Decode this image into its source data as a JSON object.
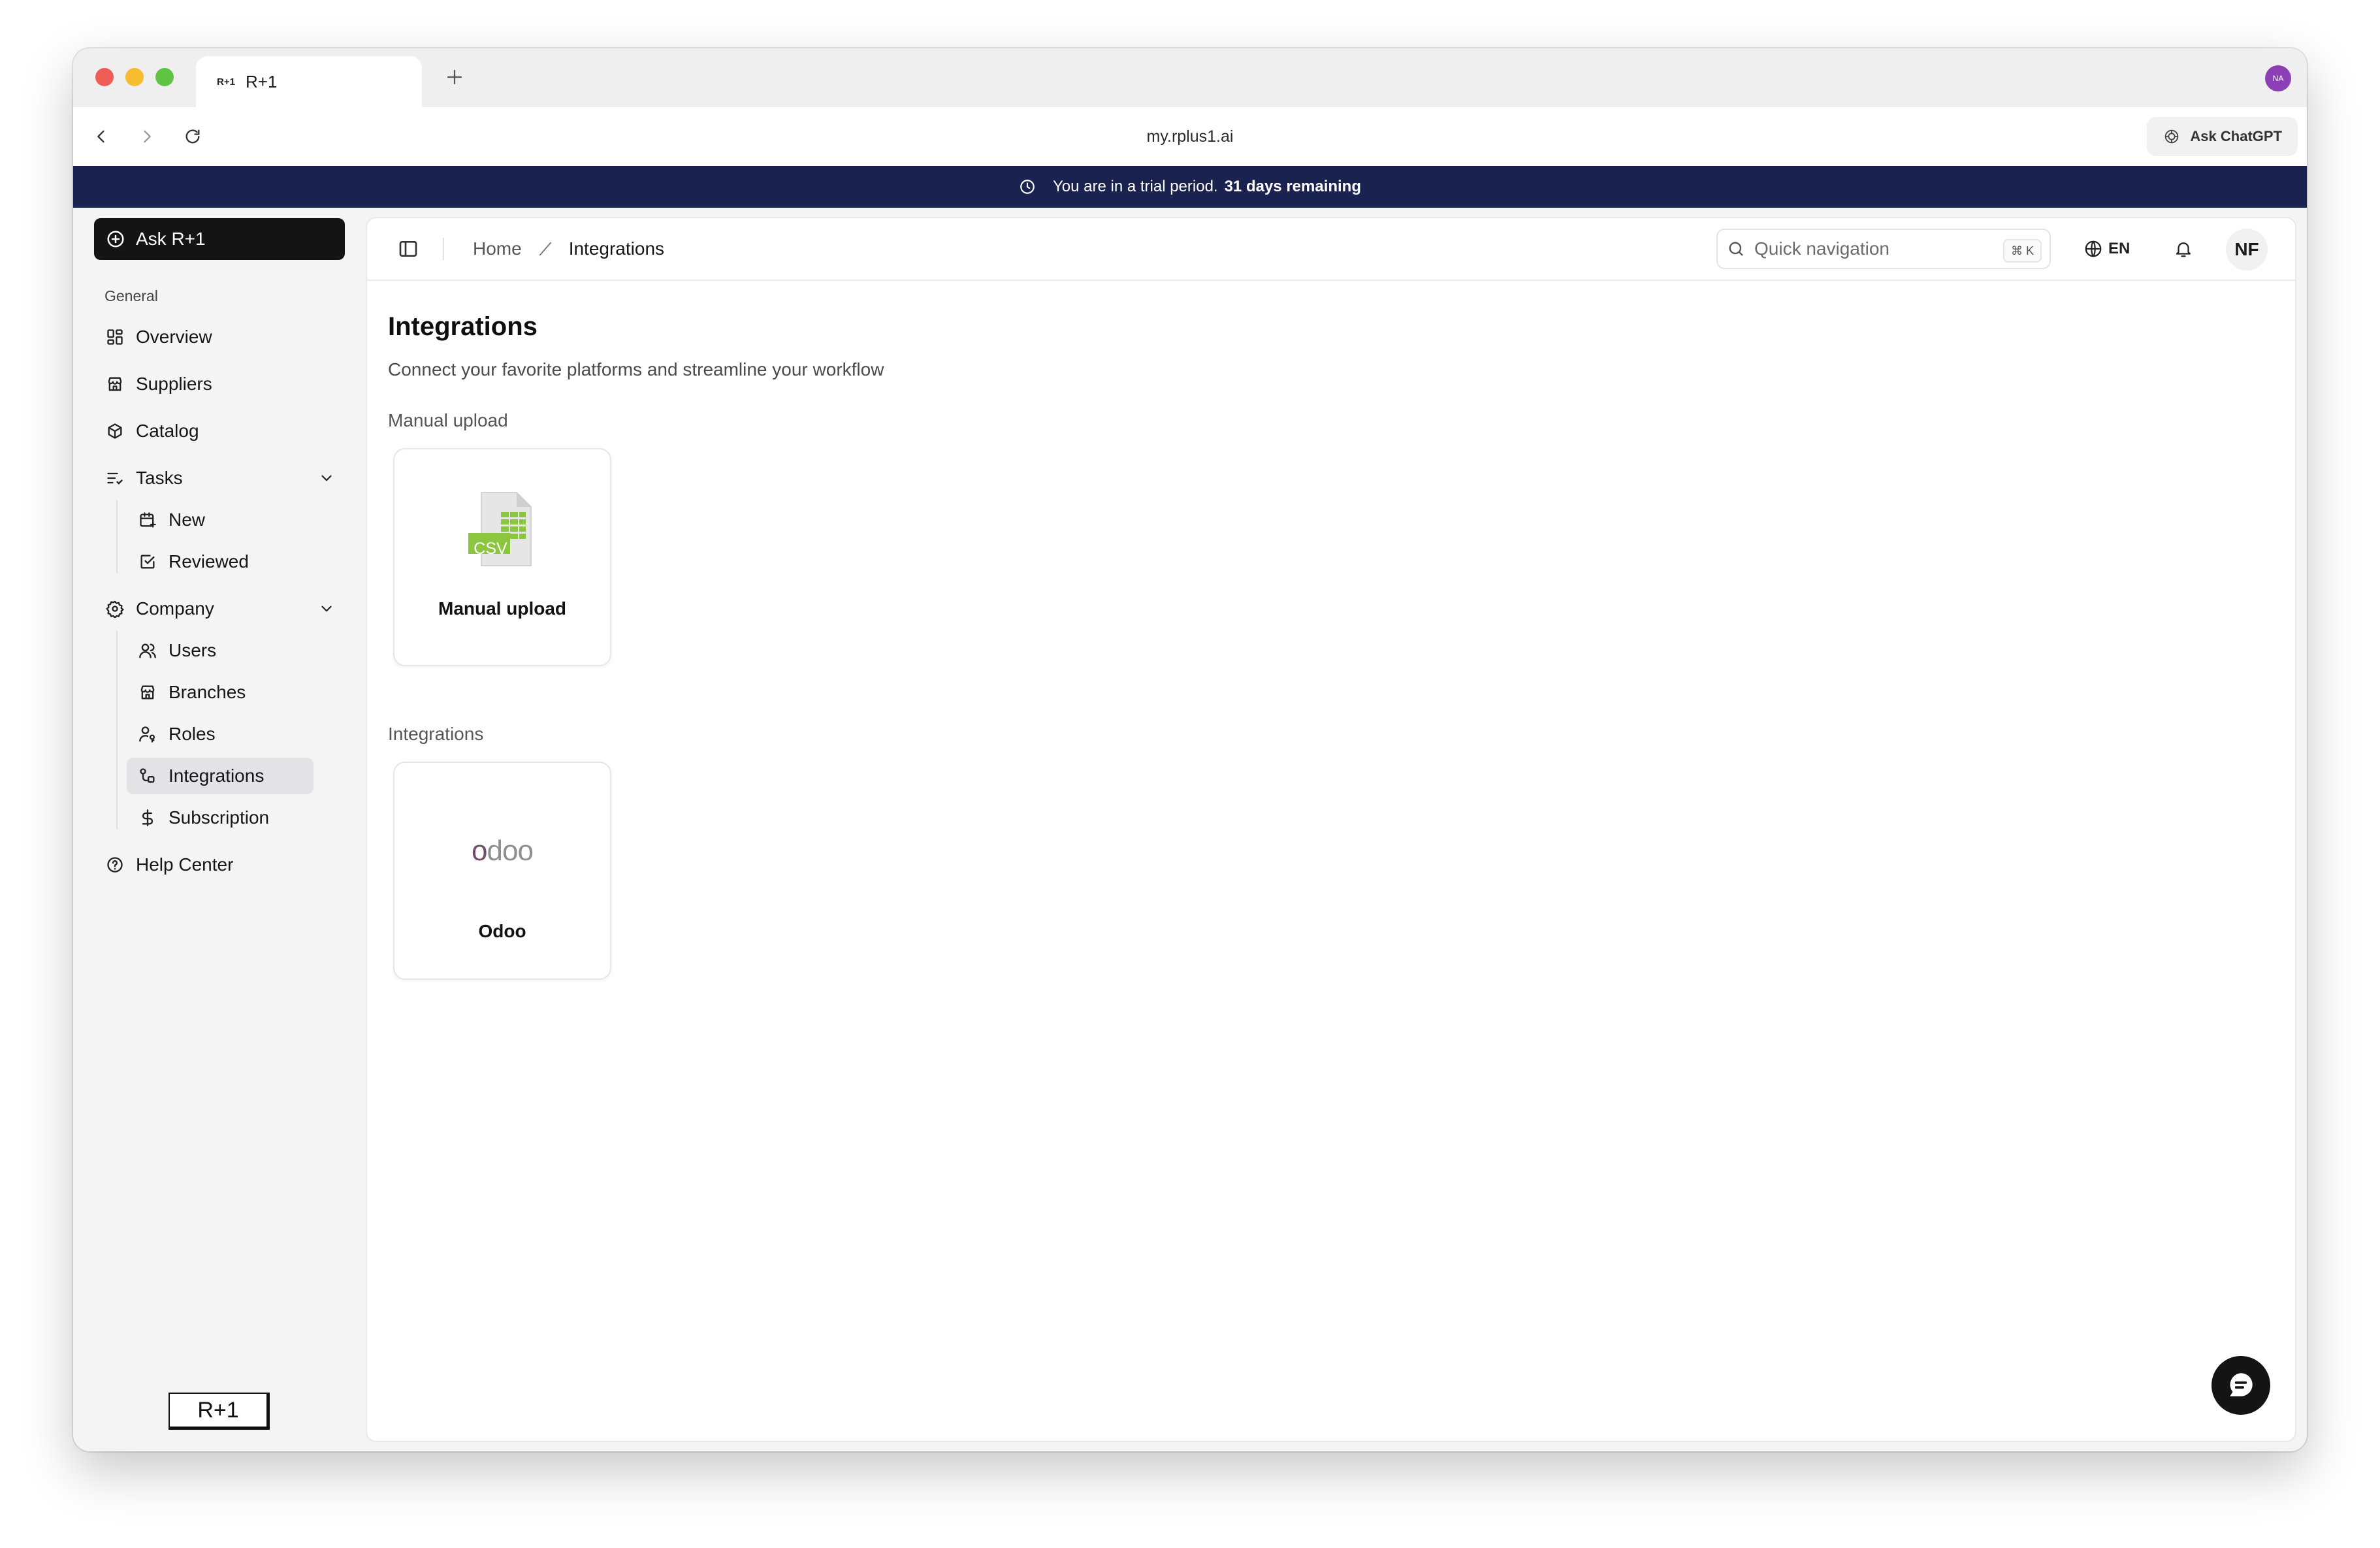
{
  "browser": {
    "tab_favicon": "R+1",
    "tab_title": "R+1",
    "url": "my.rplus1.ai",
    "ask_chatgpt": "Ask ChatGPT",
    "profile_initials": "NA"
  },
  "banner": {
    "text": "You are in a trial period.",
    "emphasis": "31 days remaining"
  },
  "sidebar": {
    "ask_button": "Ask R+1",
    "section_label": "General",
    "items": {
      "overview": "Overview",
      "suppliers": "Suppliers",
      "catalog": "Catalog",
      "tasks": "Tasks",
      "tasks_new": "New",
      "tasks_reviewed": "Reviewed",
      "company": "Company",
      "users": "Users",
      "branches": "Branches",
      "roles": "Roles",
      "integrations": "Integrations",
      "subscription": "Subscription",
      "help_center": "Help Center"
    },
    "brand": "R+1"
  },
  "header": {
    "breadcrumb_home": "Home",
    "breadcrumb_current": "Integrations",
    "search_placeholder": "Quick navigation",
    "search_shortcut": "⌘ K",
    "language": "EN",
    "avatar_initials": "NF"
  },
  "page": {
    "title": "Integrations",
    "subtitle": "Connect your favorite platforms and streamline your workflow",
    "manual_section": "Manual upload",
    "manual_card_label": "Manual upload",
    "csv_badge": "CSV",
    "integrations_section": "Integrations",
    "odoo_card_label": "Odoo",
    "odoo_logo_text": "odoo"
  },
  "colors": {
    "banner_bg": "#1a2350",
    "ask_button_bg": "#141414",
    "odoo_purple": "#714b67",
    "odoo_gray": "#8f8f8f",
    "csv_green": "#8cc63f"
  }
}
